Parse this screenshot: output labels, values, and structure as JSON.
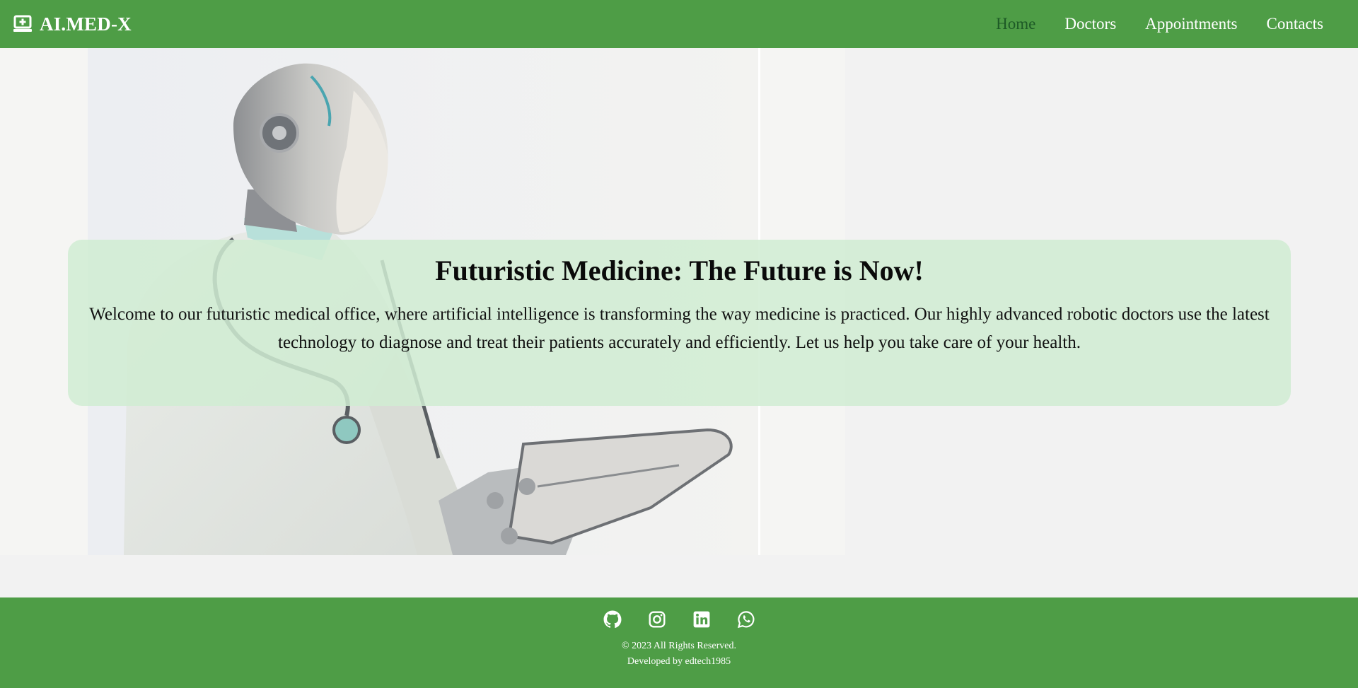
{
  "navbar": {
    "brand": "AI.MED-X",
    "brand_icon": "medical-laptop-icon",
    "links": [
      {
        "label": "Home",
        "active": true
      },
      {
        "label": "Doctors",
        "active": false
      },
      {
        "label": "Appointments",
        "active": false
      },
      {
        "label": "Contacts",
        "active": false
      }
    ]
  },
  "hero": {
    "title": "Futuristic Medicine: The Future is Now!",
    "text": "Welcome to our futuristic medical office, where artificial intelligence is transforming the way medicine is practiced. Our highly advanced robotic doctors use the latest technology to diagnose and treat their patients accurately and efficiently. Let us help you take care of your health."
  },
  "footer": {
    "social": [
      "github-icon",
      "instagram-icon",
      "linkedin-icon",
      "whatsapp-icon"
    ],
    "copyright": "© 2023 All Rights Reserved.",
    "developer": "Developed by edtech1985"
  },
  "colors": {
    "brand_green": "#4e9d46",
    "active_link": "#1d5a26",
    "card_bg": "#d0ecd2"
  }
}
